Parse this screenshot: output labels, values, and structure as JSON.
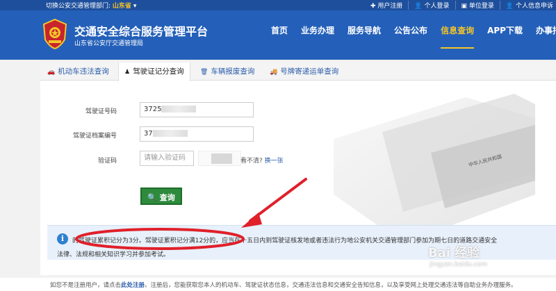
{
  "topbar": {
    "province_label": "切换公安交通管理部门:",
    "province": "山东省",
    "links": [
      "用户注册",
      "个人登录",
      "单位登录",
      "个人信息申诉"
    ]
  },
  "header": {
    "title": "交通安全综合服务管理平台",
    "subtitle": "山东省公安厅交通管理局",
    "nav": [
      "首页",
      "业务办理",
      "服务导航",
      "公告公布",
      "信息查询",
      "APP下载",
      "办事指"
    ]
  },
  "tabs": [
    {
      "label": "机动车违法查询",
      "icon": "car-icon"
    },
    {
      "label": "驾驶证记分查询",
      "icon": "person-icon"
    },
    {
      "label": "车辆报废查询",
      "icon": "trash-icon"
    },
    {
      "label": "号牌寄递运单查询",
      "icon": "truck-icon"
    }
  ],
  "form": {
    "license_label": "驾驶证号码",
    "license_value": "3725",
    "archive_label": "驾驶证档案编号",
    "archive_value": "37",
    "captcha_label": "验证码",
    "captcha_placeholder": "请输入验证码",
    "refresh_prefix": "看不清?",
    "refresh_link": "换一张",
    "query_button": "查询"
  },
  "result": {
    "line1": "的驾驶证累积记分为3分。驾驶证累积记分满12分的，应当在十五日内到驾驶证核发地或者违法行为地公安机关交通管理部门参加为期七日的道路交通安全",
    "line2": "法律、法规和相关知识学习并参加考试。"
  },
  "footer": {
    "prefix": "如您不是注册用户，请点击",
    "link": "此处注册",
    "suffix": "。注册后，您能获取您本人的机动车、驾驶证状态信息，交通违法信息和交通安全告知信息，以及享受网上处理交通违法等自助业务办理服务。"
  },
  "watermark": {
    "brand": "Bai 经验",
    "url": "jingyan.baidu.com"
  },
  "colors": {
    "header": "#2460b9",
    "topbar": "#1e4f9c",
    "active_nav": "#f5c52a",
    "button": "#2e8b3d",
    "info": "#2f80d1",
    "annotation": "#e0202a"
  }
}
